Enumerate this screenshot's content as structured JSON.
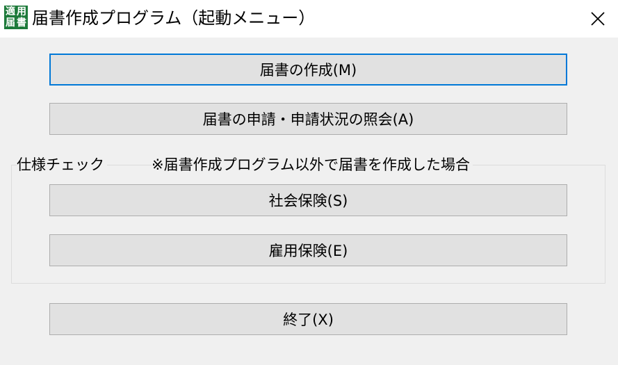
{
  "window": {
    "title": "届書作成プログラム（起動メニュー）",
    "icon_text": [
      "適",
      "用",
      "届",
      "書"
    ]
  },
  "buttons": {
    "create": "届書の作成(M)",
    "apply": "届書の申請・申請状況の照会(A)",
    "social_insurance": "社会保険(S)",
    "employment_insurance": "雇用保険(E)",
    "exit": "終了(X)"
  },
  "spec_check": {
    "label": "仕様チェック",
    "note": "※届書作成プログラム以外で届書を作成した場合"
  },
  "colors": {
    "focus_border": "#0078d7",
    "icon_bg": "#1d7a3a"
  }
}
